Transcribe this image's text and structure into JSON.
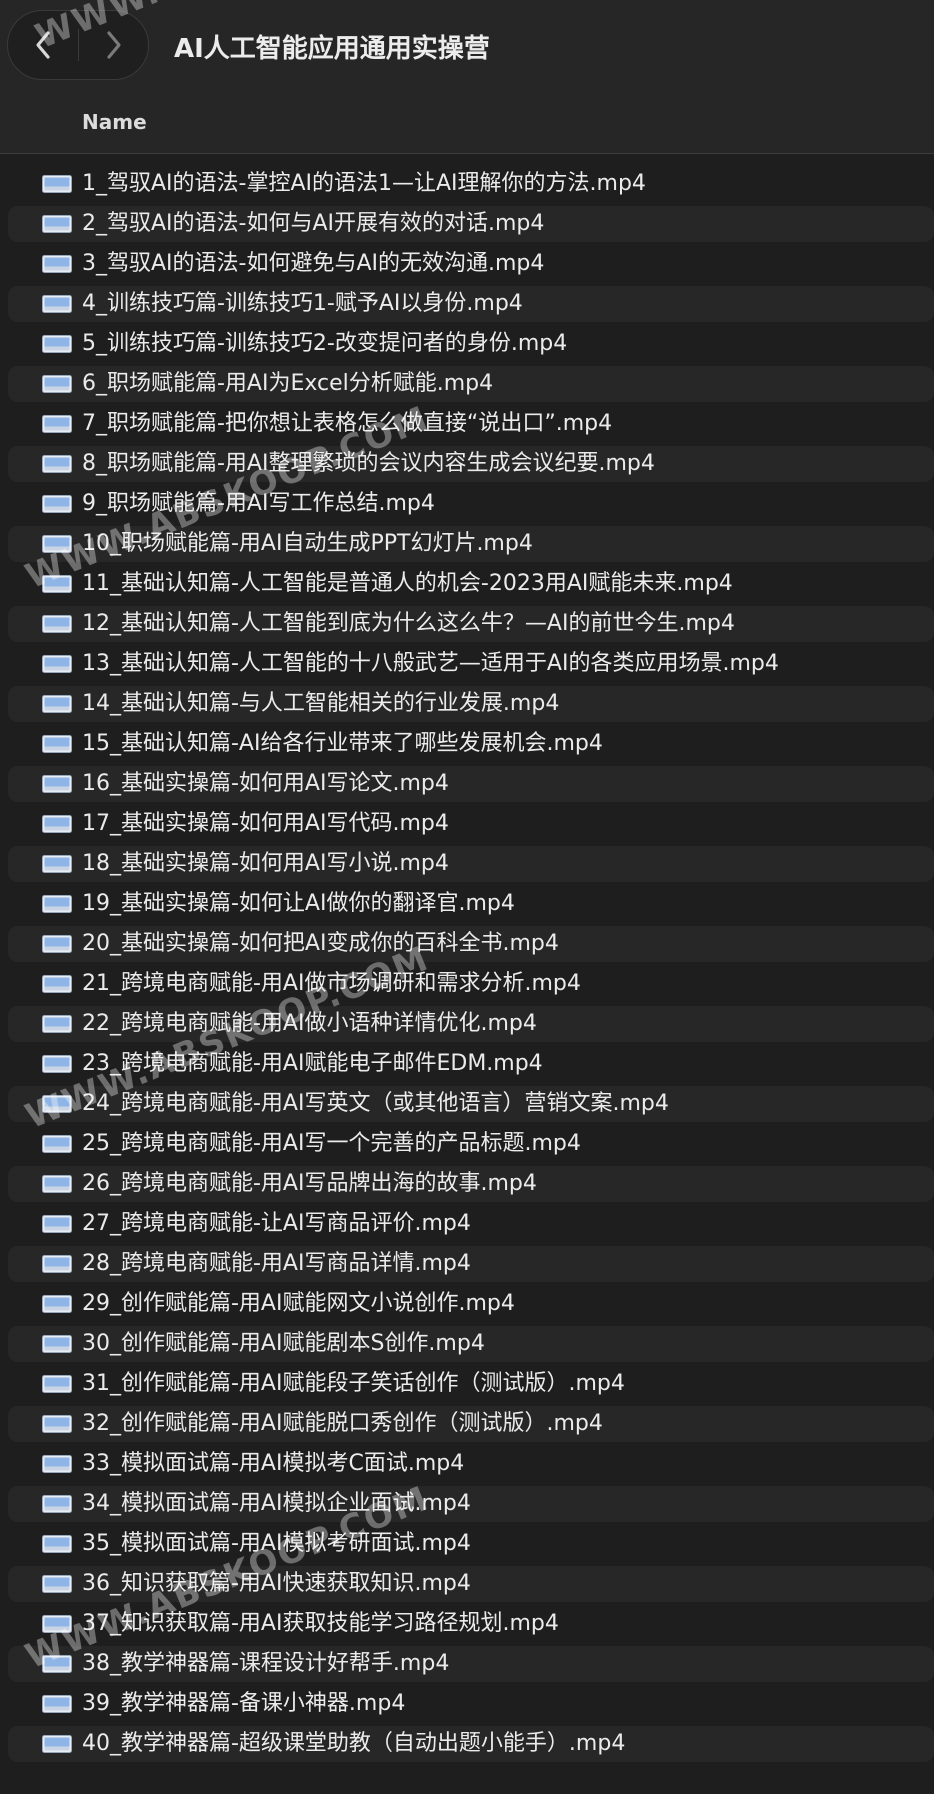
{
  "toolbar": {
    "title": "AI人工智能应用通用实操营",
    "back_icon": "chevron-left-icon",
    "forward_icon": "chevron-right-icon"
  },
  "header": {
    "name_column": "Name"
  },
  "files": [
    {
      "name": "1_驾驭AI的语法-掌控AI的语法1—让AI理解你的方法.mp4"
    },
    {
      "name": "2_驾驭AI的语法-如何与AI开展有效的对话.mp4"
    },
    {
      "name": "3_驾驭AI的语法-如何避免与AI的无效沟通.mp4"
    },
    {
      "name": "4_训练技巧篇-训练技巧1-赋予AI以身份.mp4"
    },
    {
      "name": "5_训练技巧篇-训练技巧2-改变提问者的身份.mp4"
    },
    {
      "name": "6_职场赋能篇-用AI为Excel分析赋能.mp4"
    },
    {
      "name": "7_职场赋能篇-把你想让表格怎么做直接“说出口”.mp4"
    },
    {
      "name": "8_职场赋能篇-用AI整理繁琐的会议内容生成会议纪要.mp4"
    },
    {
      "name": "9_职场赋能篇-用AI写工作总结.mp4"
    },
    {
      "name": "10_职场赋能篇-用AI自动生成PPT幻灯片.mp4"
    },
    {
      "name": "11_基础认知篇-人工智能是普通人的机会-2023用AI赋能未来.mp4"
    },
    {
      "name": "12_基础认知篇-人工智能到底为什么这么牛？—AI的前世今生.mp4"
    },
    {
      "name": "13_基础认知篇-人工智能的十八般武艺—适用于AI的各类应用场景.mp4"
    },
    {
      "name": "14_基础认知篇-与人工智能相关的行业发展.mp4"
    },
    {
      "name": "15_基础认知篇-AI给各行业带来了哪些发展机会.mp4"
    },
    {
      "name": "16_基础实操篇-如何用AI写论文.mp4"
    },
    {
      "name": "17_基础实操篇-如何用AI写代码.mp4"
    },
    {
      "name": "18_基础实操篇-如何用AI写小说.mp4"
    },
    {
      "name": "19_基础实操篇-如何让AI做你的翻译官.mp4"
    },
    {
      "name": "20_基础实操篇-如何把AI变成你的百科全书.mp4"
    },
    {
      "name": "21_跨境电商赋能-用AI做市场调研和需求分析.mp4"
    },
    {
      "name": "22_跨境电商赋能-用AI做小语种详情优化.mp4"
    },
    {
      "name": "23_跨境电商赋能-用AI赋能电子邮件EDM.mp4"
    },
    {
      "name": "24_跨境电商赋能-用AI写英文（或其他语言）营销文案.mp4"
    },
    {
      "name": "25_跨境电商赋能-用AI写一个完善的产品标题.mp4"
    },
    {
      "name": "26_跨境电商赋能-用AI写品牌出海的故事.mp4"
    },
    {
      "name": "27_跨境电商赋能-让AI写商品评价.mp4"
    },
    {
      "name": "28_跨境电商赋能-用AI写商品详情.mp4"
    },
    {
      "name": "29_创作赋能篇-用AI赋能网文小说创作.mp4"
    },
    {
      "name": "30_创作赋能篇-用AI赋能剧本S创作.mp4"
    },
    {
      "name": "31_创作赋能篇-用AI赋能段子笑话创作（测试版）.mp4"
    },
    {
      "name": "32_创作赋能篇-用AI赋能脱口秀创作（测试版）.mp4"
    },
    {
      "name": "33_模拟面试篇-用AI模拟考C面试.mp4"
    },
    {
      "name": "34_模拟面试篇-用AI模拟企业面试.mp4"
    },
    {
      "name": "35_模拟面试篇-用AI模拟考研面试.mp4"
    },
    {
      "name": "36_知识获取篇-用AI快速获取知识.mp4"
    },
    {
      "name": "37_知识获取篇-用AI获取技能学习路径规划.mp4"
    },
    {
      "name": "38_教学神器篇-课程设计好帮手.mp4"
    },
    {
      "name": "39_教学神器篇-备课小神器.mp4"
    },
    {
      "name": "40_教学神器篇-超级课堂助教（自动出题小能手）.mp4"
    }
  ],
  "watermarks": [
    {
      "text": "WWW.ABSKOOP.COM"
    },
    {
      "text": "WWW.ABSKOOP.COM"
    },
    {
      "text": "WWW.ABSKOOP.COM"
    },
    {
      "text": "WWW.ABSKOOP.COM"
    }
  ],
  "colors": {
    "background": "#1e1e1e",
    "toolbar": "#262626",
    "row_alt": "#272727",
    "text": "#ebebeb"
  },
  "icons": {
    "file": "video-file-icon"
  }
}
